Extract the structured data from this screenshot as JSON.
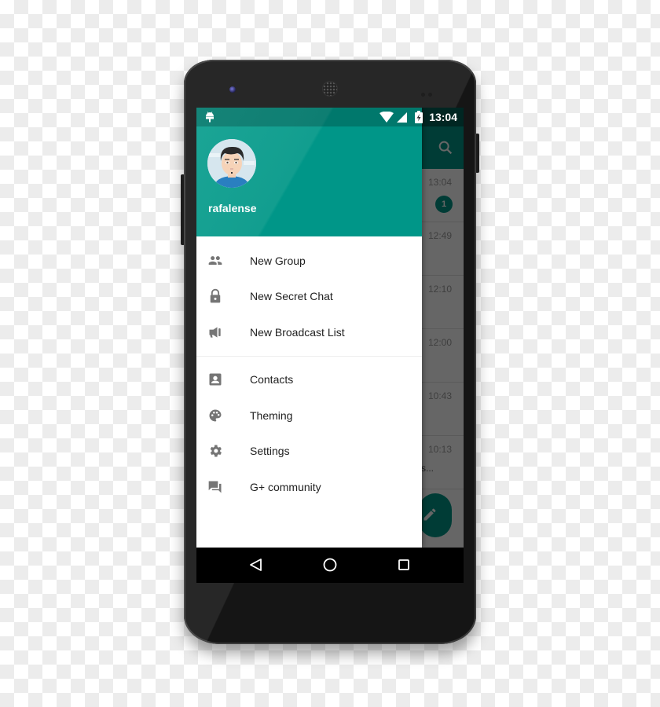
{
  "status_bar": {
    "time": "13:04",
    "icons": [
      "android-debug-icon",
      "wifi-icon",
      "cell-signal-icon",
      "battery-charging-icon"
    ]
  },
  "background_app": {
    "toolbar_icon": "search-icon",
    "chats": [
      {
        "time": "13:04",
        "unread": "1",
        "snippet": ""
      },
      {
        "time": "12:49",
        "unread": "",
        "snippet": ""
      },
      {
        "time": "12:10",
        "unread": "",
        "snippet": ""
      },
      {
        "time": "12:00",
        "unread": "",
        "snippet": ""
      },
      {
        "time": "10:43",
        "unread": "",
        "snippet": ""
      },
      {
        "time": "10:13",
        "unread": "",
        "snippet": "s..."
      }
    ],
    "fab_icon": "pencil-icon"
  },
  "drawer": {
    "username": "rafalense",
    "primary_items": [
      {
        "label": "New Group",
        "icon": "group-icon"
      },
      {
        "label": "New Secret Chat",
        "icon": "lock-icon"
      },
      {
        "label": "New Broadcast List",
        "icon": "megaphone-icon"
      }
    ],
    "secondary_items": [
      {
        "label": "Contacts",
        "icon": "contact-icon"
      },
      {
        "label": "Theming",
        "icon": "palette-icon"
      },
      {
        "label": "Settings",
        "icon": "gear-icon"
      },
      {
        "label": "G+ community",
        "icon": "forum-icon"
      }
    ]
  },
  "nav_bar": {
    "back": "back-icon",
    "home": "home-icon",
    "recents": "recents-icon"
  },
  "colors": {
    "primary": "#009688",
    "primary_dark": "#00796b",
    "icon_gray": "#757575",
    "text": "#212121"
  }
}
